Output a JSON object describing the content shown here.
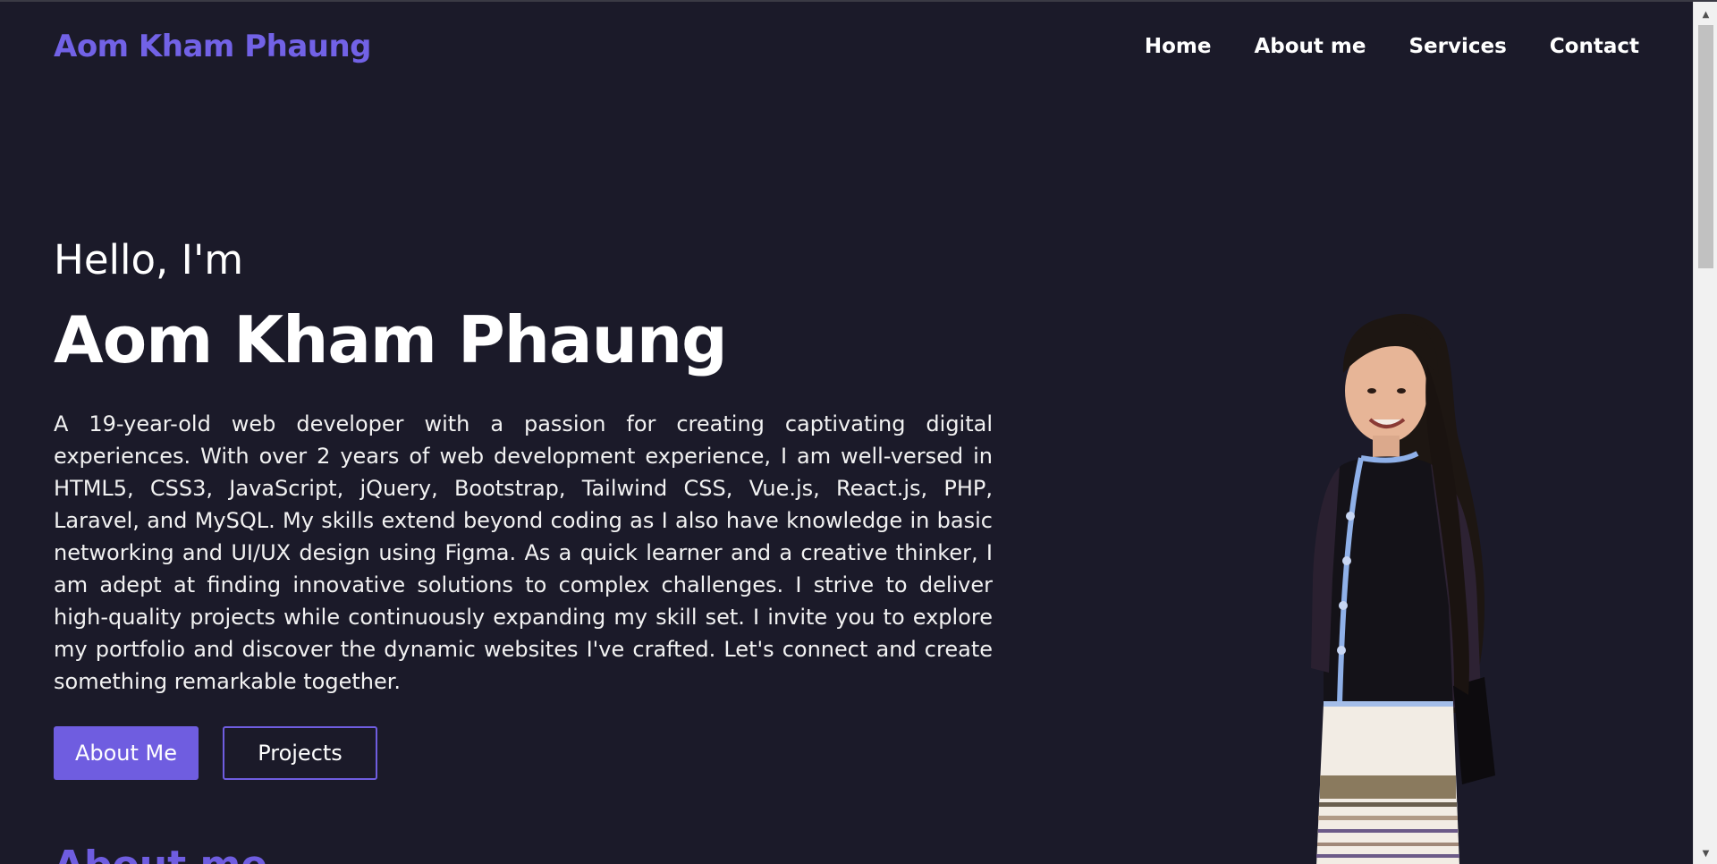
{
  "brand": "Aom Kham Phaung",
  "nav": {
    "items": [
      "Home",
      "About me",
      "Services",
      "Contact"
    ]
  },
  "hero": {
    "greeting": "Hello, I'm",
    "name": "Aom Kham Phaung",
    "bio": "A 19-year-old web developer with a passion for creating captivating digital experiences. With over 2 years of web development experience, I am well-versed in HTML5, CSS3, JavaScript, jQuery, Bootstrap, Tailwind CSS, Vue.js, React.js, PHP, Laravel, and MySQL. My skills extend beyond coding as I also have knowledge in basic networking and UI/UX design using Figma. As a quick learner and a creative thinker, I am adept at finding innovative solutions to complex challenges. I strive to deliver high-quality projects while continuously expanding my skill set. I invite you to explore my portfolio and discover the dynamic websites I've crafted. Let's connect and create something remarkable together.",
    "buttons": {
      "primary": "About Me",
      "secondary": "Projects"
    },
    "portrait_icon": "person-photo"
  },
  "next_section_heading": "About me",
  "colors": {
    "background": "#1b1a29",
    "accent": "#6f5de0",
    "brand": "#7262e6",
    "text": "#ffffff"
  }
}
